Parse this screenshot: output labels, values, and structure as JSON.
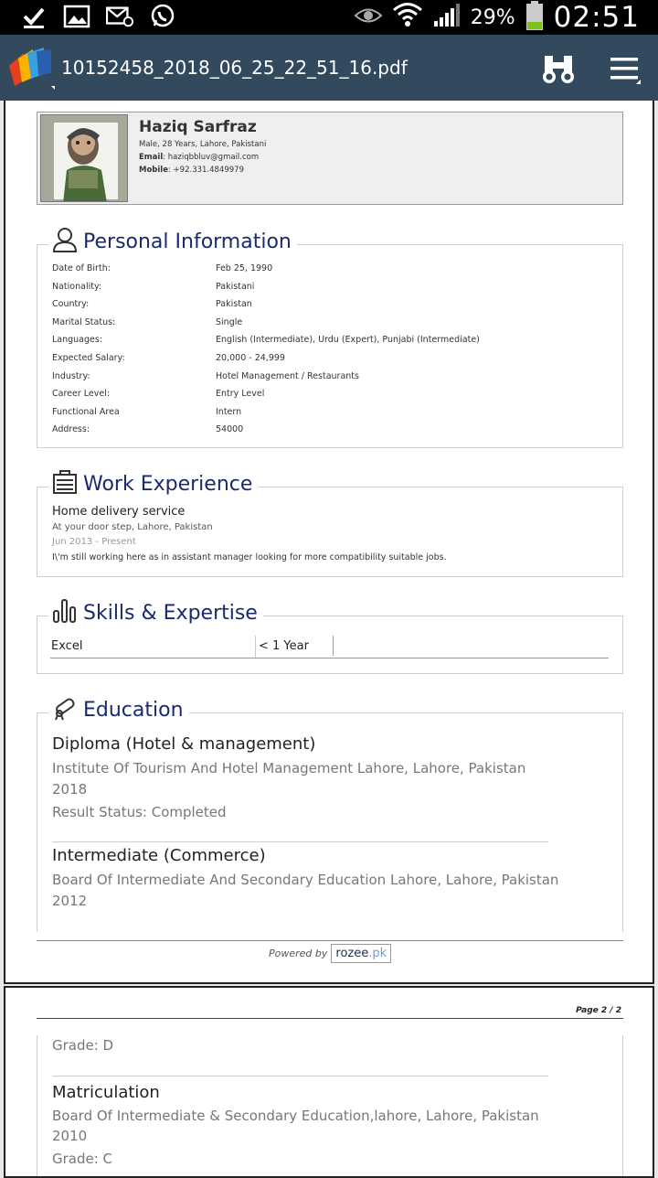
{
  "status_bar": {
    "battery_percent": "29%",
    "time": "02:51",
    "icons": [
      "check-icon",
      "image-icon",
      "mail-icon",
      "whatsapp-icon",
      "eye-icon",
      "wifi-icon",
      "signal-icon",
      "battery-icon"
    ]
  },
  "app_bar": {
    "file_name": "10152458_2018_06_25_22_51_16.pdf",
    "colors": {
      "bar": "#33495e"
    }
  },
  "profile": {
    "name": "Haziq Sarfraz",
    "summary": "Male, 28 Years, Lahore, Pakistani",
    "email_label": "Email",
    "email": ": haziqbbluv@gmail.com",
    "mobile_label": "Mobile",
    "mobile": ": +92.331.4849979"
  },
  "personal_info": {
    "title": "Personal Information",
    "rows": [
      {
        "label": "Date of Birth:",
        "value": "Feb 25, 1990"
      },
      {
        "label": "Nationality:",
        "value": "Pakistani"
      },
      {
        "label": "Country:",
        "value": "Pakistan"
      },
      {
        "label": "Marital Status:",
        "value": "Single"
      },
      {
        "label": "Languages:",
        "value": "English (Intermediate), Urdu (Expert), Punjabi (Intermediate)"
      },
      {
        "label": "Expected Salary:",
        "value": "20,000 - 24,999"
      },
      {
        "label": "Industry:",
        "value": "Hotel Management / Restaurants"
      },
      {
        "label": "Career Level:",
        "value": "Entry Level"
      },
      {
        "label": "Functional Area",
        "value": "Intern"
      },
      {
        "label": "Address:",
        "value": "54000"
      }
    ]
  },
  "work_experience": {
    "title": "Work Experience",
    "job_title": "Home delivery service",
    "company": "At your door step, Lahore, Pakistan",
    "dates": "Jun 2013 - Present",
    "description": "I\\'m still working here as in assistant manager looking for more compatibility suitable jobs."
  },
  "skills": {
    "title": "Skills & Expertise",
    "items": [
      {
        "name": "Excel",
        "experience": "< 1 Year"
      }
    ]
  },
  "education": {
    "title": "Education",
    "entries": [
      {
        "degree": "Diploma (Hotel & management)",
        "institute": "Institute Of Tourism And Hotel Management Lahore, Lahore, Pakistan",
        "year": "2018",
        "extra": "Result Status: Completed"
      },
      {
        "degree": "Intermediate (Commerce)",
        "institute": "Board Of Intermediate And Secondary Education Lahore, Lahore, Pakistan",
        "year": "2012"
      }
    ]
  },
  "footer": {
    "powered_by": "Powered by",
    "brand": "rozee",
    "brand_suffix": ".pk"
  },
  "page2": {
    "page_label": "Page 2 / 2",
    "prev_grade": "Grade: D",
    "degree": "Matriculation",
    "institute": "Board Of Intermediate & Secondary Education,lahore, Lahore, Pakistan",
    "year": "2010",
    "grade": "Grade: C"
  }
}
